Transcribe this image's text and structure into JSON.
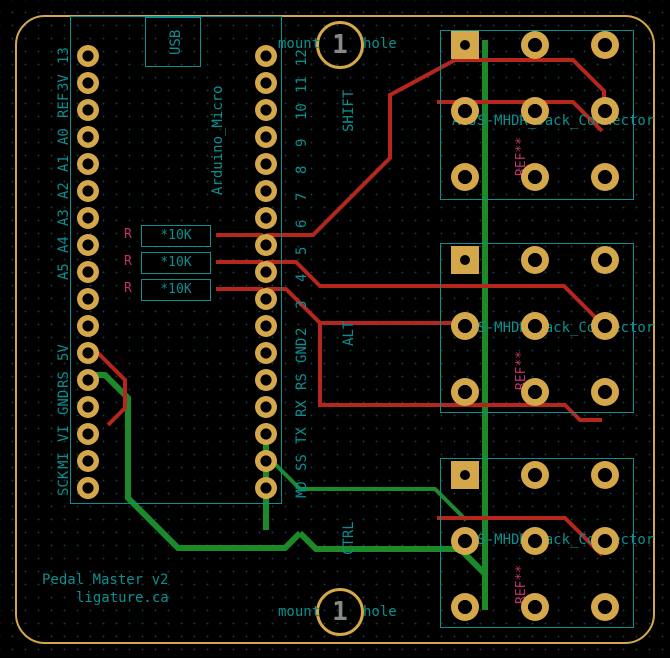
{
  "board": {
    "title": "Pedal Master v2",
    "author": "ligature.ca"
  },
  "arduino": {
    "label": "Arduino_Micro",
    "usb_label": "USB",
    "left_pins": [
      "SCK",
      "MI",
      "VI",
      "GND",
      "RS",
      "5V",
      "",
      "",
      "A5",
      "A4",
      "A3",
      "A2",
      "A1",
      "A0",
      "REF",
      "3V",
      "13"
    ],
    "right_pins": [
      "MD",
      "SS",
      "TX",
      "RX",
      "RS",
      "GND",
      "2",
      "3",
      "4",
      "5",
      "6",
      "7",
      "8",
      "9",
      "10",
      "11",
      "12"
    ]
  },
  "resistors": {
    "value": "*10K",
    "refs": [
      "R",
      "R",
      "R"
    ]
  },
  "jacks": {
    "label": "ACJS-MHDR_Jack_Connector",
    "ref": "REF**",
    "func_labels": [
      "SHIFT",
      "ALT",
      "CTRL"
    ]
  },
  "mount": {
    "label_left": "mount",
    "label_right": "hole",
    "num": "1"
  }
}
